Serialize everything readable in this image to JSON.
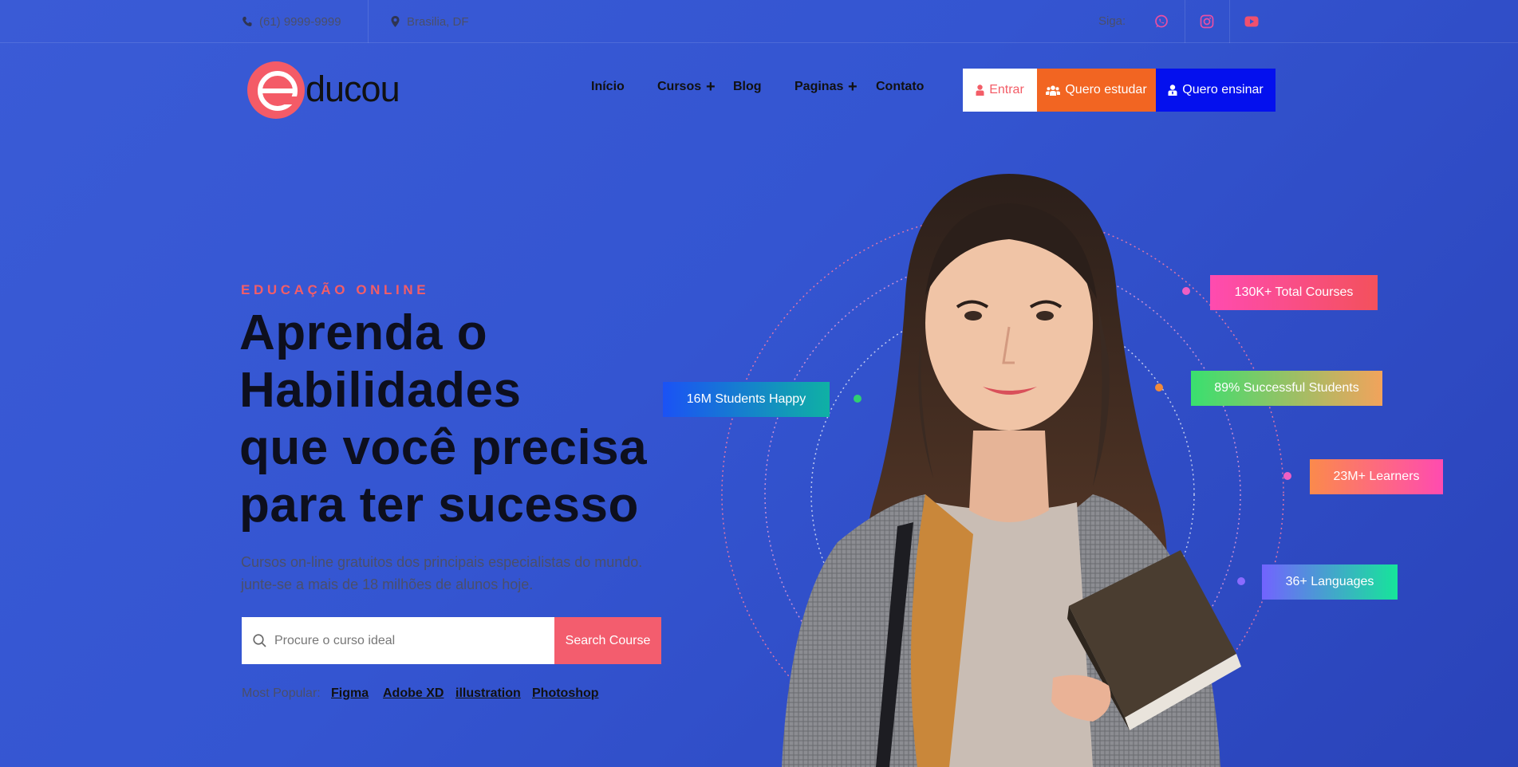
{
  "topbar": {
    "phone": "(61) 9999-9999",
    "location": "Brasilia, DF",
    "follow_label": "Siga:",
    "social": [
      {
        "name": "whatsapp-icon",
        "color": "#e94fa3"
      },
      {
        "name": "instagram-icon",
        "color": "#e94fa3"
      },
      {
        "name": "youtube-icon",
        "color": "#f0506e"
      }
    ]
  },
  "header": {
    "logo_text": "ducou",
    "logo_letter": "e",
    "nav": {
      "inicio": "Início",
      "cursos": "Cursos",
      "blog": "Blog",
      "paginas": "Paginas",
      "contato": "Contato",
      "plus": "+"
    },
    "buttons": {
      "entrar": "Entrar",
      "estudar": "Quero estudar",
      "ensinar": "Quero ensinar"
    }
  },
  "hero": {
    "eyebrow": "EDUCAÇÃO ONLINE",
    "headline": [
      "Aprenda o",
      "Habilidades",
      "que você precisa",
      "para ter sucesso"
    ],
    "subtitle": "Cursos on-line gratuitos dos principais especialistas do mundo. junte-se a mais de 18 milhões de alunos hoje.",
    "search": {
      "placeholder": "Procure o curso ideal",
      "button": "Search Course"
    },
    "popular": {
      "label": "Most Popular:",
      "tags": [
        "Figma",
        "Adobe XD",
        "illustration",
        "Photoshop"
      ]
    }
  },
  "stats": {
    "total_courses": "130K+ Total Courses",
    "happy_students": "16M Students Happy",
    "successful": "89% Successful Students",
    "learners": "23M+ Learners",
    "languages": "36+ Languages"
  },
  "colors": {
    "accent": "#f35d67",
    "orange": "#f26522",
    "blue_button": "#0410ee",
    "background": "#3455d1"
  }
}
